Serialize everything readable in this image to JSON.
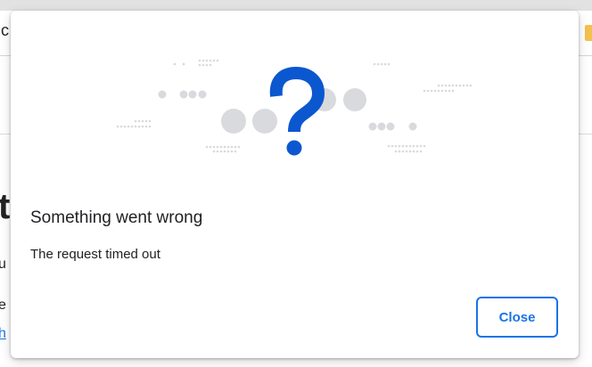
{
  "background": {
    "fragments": [
      "c",
      "t",
      "u",
      "e",
      "h"
    ]
  },
  "dialog": {
    "illustration_icon": "question-mark-icon",
    "title": "Something went wrong",
    "message": "The request timed out",
    "close_label": "Close",
    "accent_color": "#1a73e8",
    "icon_color": "#0b57d0",
    "dot_color": "#d9dadd"
  }
}
